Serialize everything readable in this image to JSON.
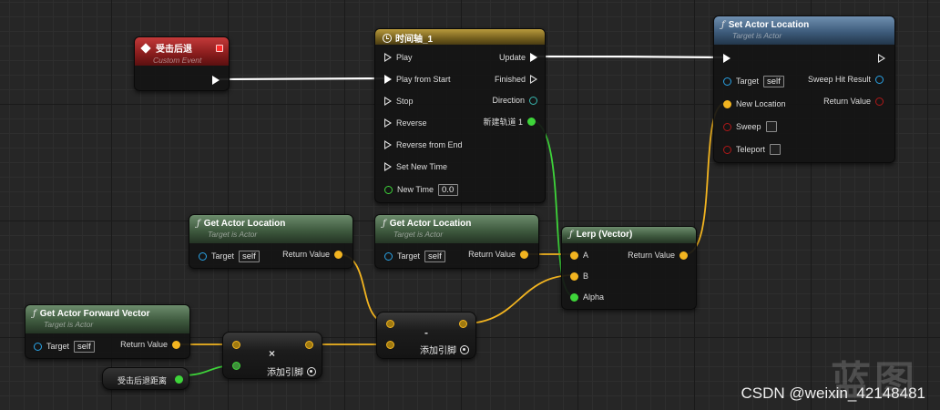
{
  "colors": {
    "exec": "#ffffff",
    "vector_wire": "#f2b420",
    "float_wire": "#3ed43a",
    "object_pin": "#2aa3e6",
    "bool_pin": "#b01818",
    "custom_event_header": "#8c1e1e",
    "timeline_header": "#7a6420",
    "function_header": "#3f5a3f",
    "target_function_header": "#3e5c7c"
  },
  "nodes": {
    "custom_event": {
      "title": "受击后退",
      "subtitle": "Custom Event",
      "icon": "event-diamond-icon"
    },
    "timeline": {
      "title": "时间轴_1",
      "icon": "clock-icon",
      "inputs": {
        "play": "Play",
        "play_from_start": "Play from Start",
        "stop": "Stop",
        "reverse": "Reverse",
        "reverse_from_end": "Reverse from End",
        "set_new_time": "Set New Time",
        "new_time": "New Time",
        "new_time_value": "0.0"
      },
      "outputs": {
        "update": "Update",
        "finished": "Finished",
        "direction": "Direction",
        "track": "新建轨道 1"
      }
    },
    "set_actor_location": {
      "title": "Set Actor Location",
      "subtitle": "Target is Actor",
      "icon": "function-icon",
      "inputs": {
        "target": "Target",
        "target_value": "self",
        "new_location": "New Location",
        "sweep": "Sweep",
        "teleport": "Teleport"
      },
      "outputs": {
        "sweep_hit_result": "Sweep Hit Result",
        "return_value": "Return Value"
      }
    },
    "get_actor_location_1": {
      "title": "Get Actor Location",
      "subtitle": "Target is Actor",
      "icon": "function-icon",
      "target": "Target",
      "target_value": "self",
      "return_value": "Return Value"
    },
    "get_actor_location_2": {
      "title": "Get Actor Location",
      "subtitle": "Target is Actor",
      "icon": "function-icon",
      "target": "Target",
      "target_value": "self",
      "return_value": "Return Value"
    },
    "lerp": {
      "title": "Lerp (Vector)",
      "icon": "function-icon",
      "a": "A",
      "b": "B",
      "alpha": "Alpha",
      "return_value": "Return Value"
    },
    "get_forward_vector": {
      "title": "Get Actor Forward Vector",
      "subtitle": "Target is Actor",
      "icon": "function-icon",
      "target": "Target",
      "target_value": "self",
      "return_value": "Return Value"
    },
    "multiply": {
      "symbol": "×",
      "add_pin": "添加引脚"
    },
    "subtract": {
      "symbol": "-",
      "add_pin": "添加引脚"
    },
    "variable": {
      "label": "受击后退距离"
    }
  },
  "watermark": {
    "text": "CSDN @weixin_42148481",
    "logo": "蓝图"
  }
}
